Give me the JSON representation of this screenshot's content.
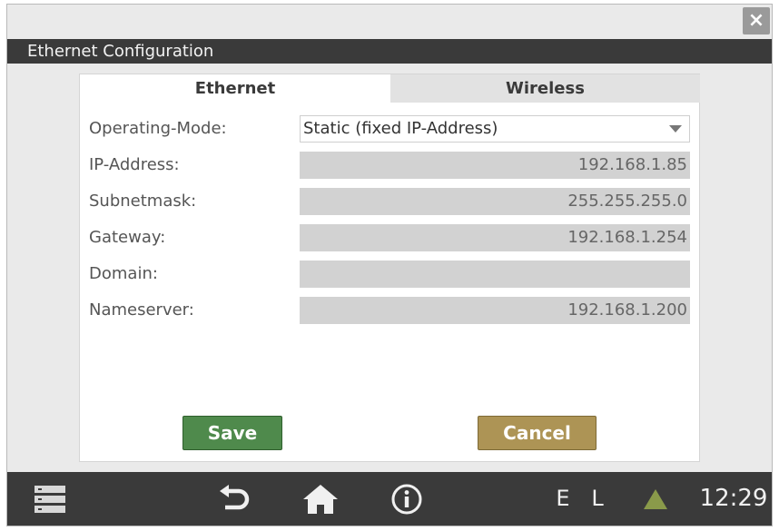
{
  "window": {
    "title": "Ethernet Configuration",
    "close_label": "×"
  },
  "tabs": [
    {
      "label": "Ethernet",
      "active": true
    },
    {
      "label": "Wireless",
      "active": false
    }
  ],
  "form": {
    "operating_mode": {
      "label": "Operating-Mode:",
      "value": "Static (fixed IP-Address)"
    },
    "ip_address": {
      "label": "IP-Address:",
      "value": "192.168.1.85"
    },
    "subnetmask": {
      "label": "Subnetmask:",
      "value": "255.255.255.0"
    },
    "gateway": {
      "label": "Gateway:",
      "value": "192.168.1.254"
    },
    "domain": {
      "label": "Domain:",
      "value": ""
    },
    "nameserver": {
      "label": "Nameserver:",
      "value": "192.168.1.200"
    }
  },
  "buttons": {
    "save_label": "Save",
    "cancel_label": "Cancel"
  },
  "taskbar": {
    "icons": [
      "menu-icon",
      "back-icon",
      "home-icon",
      "info-icon",
      "warning-icon"
    ],
    "status_letters": [
      "E",
      "L"
    ],
    "clock": "12:29"
  },
  "colors": {
    "save_button": "#4f8a4c",
    "cancel_button": "#ad9455",
    "title_bar": "#3a3a3a",
    "warning": "#8a9a4a"
  }
}
